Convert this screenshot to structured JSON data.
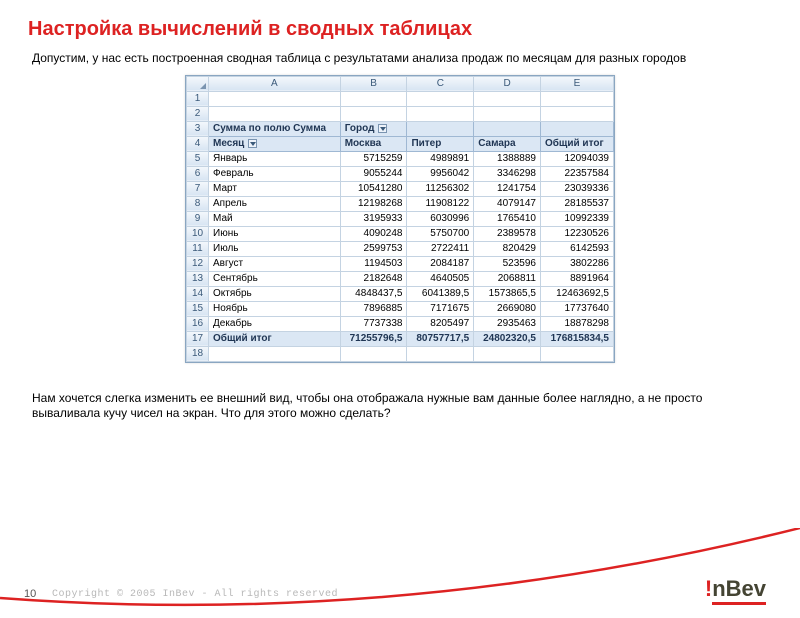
{
  "title": "Настройка вычислений в сводных таблицах",
  "intro": "Допустим, у нас есть построенная сводная таблица с результатами анализа продаж по месяцам для разных городов",
  "outro": "Нам хочется слегка изменить ее внешний вид, чтобы она отображала нужные вам данные более наглядно, а не просто вываливала кучу чисел на экран. Что для этого можно сделать?",
  "page_number": "10",
  "copyright": "Copyright © 2005 InBev - All rights reserved",
  "logo": {
    "bang": "!",
    "rest": "nBev"
  },
  "sheet": {
    "columns": [
      "A",
      "B",
      "C",
      "D",
      "E"
    ],
    "pivot_label": "Сумма по полю Сумма",
    "city_label": "Город",
    "month_label": "Месяц",
    "cities": [
      "Москва",
      "Питер",
      "Самара",
      "Общий итог"
    ],
    "total_label": "Общий итог",
    "rows": [
      {
        "m": "Январь",
        "v": [
          "5715259",
          "4989891",
          "1388889",
          "12094039"
        ]
      },
      {
        "m": "Февраль",
        "v": [
          "9055244",
          "9956042",
          "3346298",
          "22357584"
        ]
      },
      {
        "m": "Март",
        "v": [
          "10541280",
          "11256302",
          "1241754",
          "23039336"
        ]
      },
      {
        "m": "Апрель",
        "v": [
          "12198268",
          "11908122",
          "4079147",
          "28185537"
        ]
      },
      {
        "m": "Май",
        "v": [
          "3195933",
          "6030996",
          "1765410",
          "10992339"
        ]
      },
      {
        "m": "Июнь",
        "v": [
          "4090248",
          "5750700",
          "2389578",
          "12230526"
        ]
      },
      {
        "m": "Июль",
        "v": [
          "2599753",
          "2722411",
          "820429",
          "6142593"
        ]
      },
      {
        "m": "Август",
        "v": [
          "1194503",
          "2084187",
          "523596",
          "3802286"
        ]
      },
      {
        "m": "Сентябрь",
        "v": [
          "2182648",
          "4640505",
          "2068811",
          "8891964"
        ]
      },
      {
        "m": "Октябрь",
        "v": [
          "4848437,5",
          "6041389,5",
          "1573865,5",
          "12463692,5"
        ]
      },
      {
        "m": "Ноябрь",
        "v": [
          "7896885",
          "7171675",
          "2669080",
          "17737640"
        ]
      },
      {
        "m": "Декабрь",
        "v": [
          "7737338",
          "8205497",
          "2935463",
          "18878298"
        ]
      }
    ],
    "grand_total": [
      "71255796,5",
      "80757717,5",
      "24802320,5",
      "176815834,5"
    ]
  }
}
